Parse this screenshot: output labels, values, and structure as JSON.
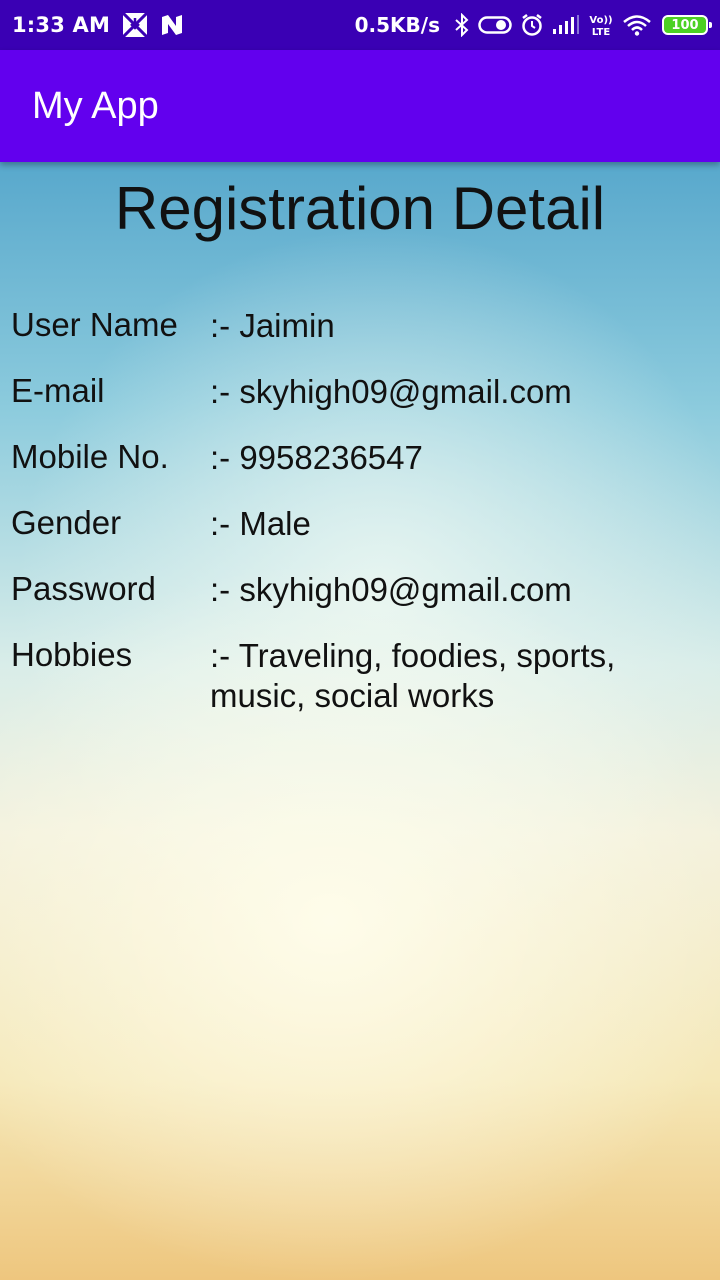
{
  "status_bar": {
    "time": "1:33 AM",
    "net_speed": "0.5KB/s",
    "network": "LTE",
    "battery": "100"
  },
  "app_bar": {
    "title": "My App"
  },
  "page": {
    "title": "Registration Detail"
  },
  "details": [
    {
      "label": "User Name",
      "value": ":- Jaimin"
    },
    {
      "label": "E-mail",
      "value": ":- skyhigh09@gmail.com"
    },
    {
      "label": "Mobile No.",
      "value": ":- 9958236547"
    },
    {
      "label": "Gender",
      "value": ":- Male"
    },
    {
      "label": "Password",
      "value": ":- skyhigh09@gmail.com"
    },
    {
      "label": "Hobbies",
      "value": ":- Traveling, foodies, sports, music, social works"
    }
  ],
  "colors": {
    "status_bar": "#3a00b4",
    "app_bar": "#6200ee"
  }
}
